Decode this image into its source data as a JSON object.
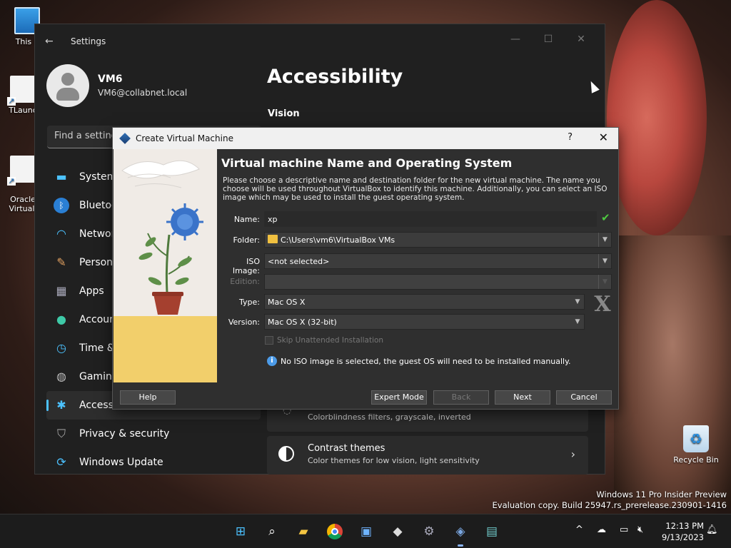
{
  "desktop": {
    "icons": [
      {
        "label": "This P"
      },
      {
        "label": "TLaunc"
      },
      {
        "label": "Oracle\nVirtuall"
      },
      {
        "label": "Recycle Bin"
      }
    ]
  },
  "settings": {
    "title": "Settings",
    "user": {
      "name": "VM6",
      "email": "VM6@collabnet.local"
    },
    "search_placeholder": "Find a setting",
    "nav": [
      {
        "label": "System",
        "icon": "monitor-icon"
      },
      {
        "label": "Bluetoot",
        "icon": "bluetooth-icon"
      },
      {
        "label": "Network",
        "icon": "wifi-icon"
      },
      {
        "label": "Persona",
        "icon": "brush-icon"
      },
      {
        "label": "Apps",
        "icon": "apps-icon"
      },
      {
        "label": "Account",
        "icon": "account-icon"
      },
      {
        "label": "Time &",
        "icon": "clock-icon"
      },
      {
        "label": "Gaming",
        "icon": "gamepad-icon"
      },
      {
        "label": "Accessib",
        "icon": "accessibility-icon"
      },
      {
        "label": "Privacy & security",
        "icon": "shield-icon"
      },
      {
        "label": "Windows Update",
        "icon": "update-icon"
      }
    ],
    "page_title": "Accessibility",
    "section": "Vision",
    "cards": [
      {
        "title": "",
        "subtitle": "Colorblindness filters, grayscale, inverted"
      },
      {
        "title": "Contrast themes",
        "subtitle": "Color themes for low vision, light sensitivity"
      }
    ]
  },
  "vbox": {
    "title": "Create Virtual Machine",
    "help_glyph": "?",
    "close_glyph": "✕",
    "heading": "Virtual machine Name and Operating System",
    "description": "Please choose a descriptive name and destination folder for the new virtual machine. The name you choose will be used throughout VirtualBox to identify this machine. Additionally, you can select an ISO image which may be used to install the guest operating system.",
    "labels": {
      "name": "Name:",
      "folder": "Folder:",
      "iso": "ISO Image:",
      "edition": "Edition:",
      "type": "Type:",
      "version": "Version:"
    },
    "values": {
      "name": "xp",
      "folder": "C:\\Users\\vm6\\VirtualBox VMs",
      "iso": "<not selected>",
      "edition": "",
      "type": "Mac OS X",
      "version": "Mac OS X (32-bit)"
    },
    "os_badge": "X",
    "skip_unattended": "Skip Unattended Installation",
    "info": "No ISO image is selected, the guest OS will need to be installed manually.",
    "buttons": {
      "help": "Help",
      "expert": "Expert Mode",
      "back": "Back",
      "next": "Next",
      "cancel": "Cancel"
    }
  },
  "watermark": {
    "line1": "Windows 11 Pro Insider Preview",
    "line2": "Evaluation copy. Build 25947.rs_prerelease.230901-1416"
  },
  "taskbar": {
    "time": "12:13 PM",
    "date": "9/13/2023"
  },
  "colors": {
    "accent": "#4cc2ff",
    "ok_check": "#4ec840",
    "info_blue": "#4c9be8"
  }
}
